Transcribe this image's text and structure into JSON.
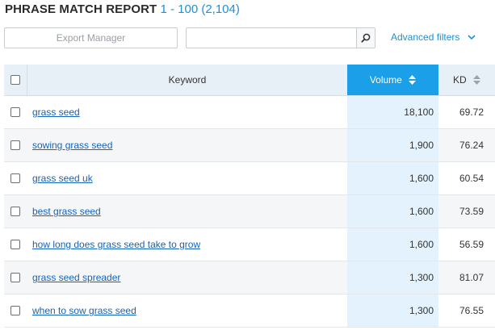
{
  "report": {
    "title": "PHRASE MATCH REPORT",
    "range": "1 - 100 (2,104)"
  },
  "toolbar": {
    "export_label": "Export Manager",
    "search_value": "",
    "search_placeholder": "",
    "advanced_filters_label": "Advanced filters"
  },
  "table": {
    "columns": {
      "keyword": "Keyword",
      "volume": "Volume",
      "kd": "KD"
    },
    "sorted_column": "volume",
    "rows": [
      {
        "keyword": "grass seed",
        "volume": "18,100",
        "kd": "69.72"
      },
      {
        "keyword": "sowing grass seed",
        "volume": "1,900",
        "kd": "76.24"
      },
      {
        "keyword": "grass seed uk",
        "volume": "1,600",
        "kd": "60.54"
      },
      {
        "keyword": "best grass seed",
        "volume": "1,600",
        "kd": "73.59"
      },
      {
        "keyword": "how long does grass seed take to grow",
        "volume": "1,600",
        "kd": "56.59"
      },
      {
        "keyword": "grass seed spreader",
        "volume": "1,300",
        "kd": "81.07"
      },
      {
        "keyword": "when to sow grass seed",
        "volume": "1,300",
        "kd": "76.55"
      }
    ]
  },
  "colors": {
    "accent": "#1a9fe8",
    "link": "#1563ba",
    "header_bg": "#e8f0f7",
    "sorted_column_bg": "#e3f2fc"
  },
  "icons": {
    "search": "magnifier-icon",
    "dropdown": "chevron-down-icon",
    "sort": "sort-arrows-icon"
  }
}
